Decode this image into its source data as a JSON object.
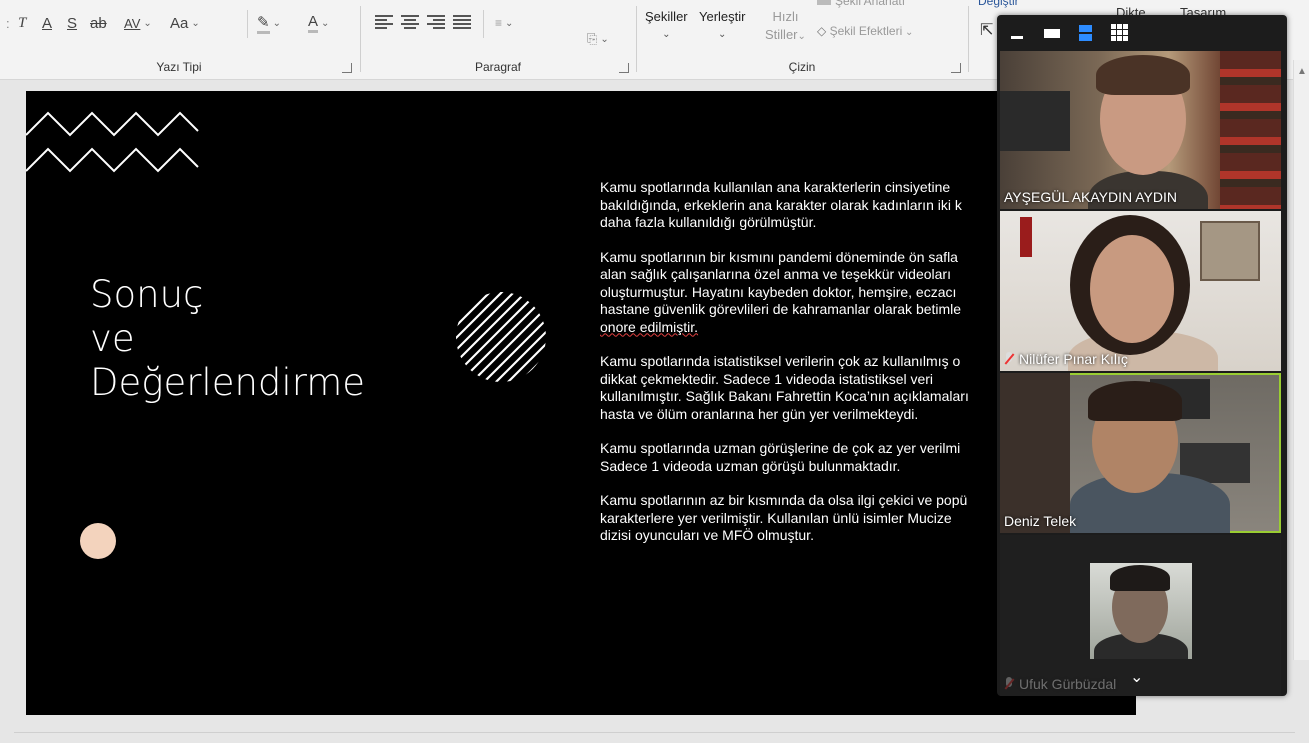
{
  "ribbon": {
    "font_group": {
      "label": "Yazı Tipi",
      "buttons": {
        "italic": "T",
        "underline": "A",
        "shadow": "S",
        "strike": "ab",
        "spacing": "AV",
        "case": "Aa",
        "highlight": "✎",
        "font_color": "A"
      }
    },
    "paragraph_group": {
      "label": "Paragraf"
    },
    "drawing_group": {
      "label": "Çizin",
      "shapes_label": "Şekiller",
      "arrange_label": "Yerleştir",
      "quick_styles_label_1": "Hızlı",
      "quick_styles_label_2": "Stiller",
      "shape_fill_label": "Şekil Anahatı",
      "shape_effects_label": "Şekil Efektleri",
      "change_label": "Değiştir"
    },
    "right_tabs": [
      "Dikte",
      "Tasarım"
    ]
  },
  "slide": {
    "title_lines": [
      "Sonuç",
      "ve",
      "Değerlendirme"
    ],
    "paragraphs": [
      [
        "Kamu spotlarında kullanılan ana karakterlerin cinsiyetine",
        "bakıldığında, erkeklerin ana karakter olarak kadınların iki k",
        "daha fazla kullanıldığı görülmüştür."
      ],
      [
        "Kamu spotlarının bir kısmını pandemi döneminde ön safla",
        "alan sağlık çalışanlarına özel anma ve teşekkür videoları",
        "oluşturmuştur. Hayatını kaybeden doktor, hemşire, eczacı",
        "hastane güvenlik görevlileri de kahramanlar olarak betimle",
        "onore edilmiştir."
      ],
      [
        "Kamu spotlarında istatistiksel verilerin çok az kullanılmış o",
        "dikkat çekmektedir. Sadece 1 videoda istatistiksel veri",
        "kullanılmıştır. Sağlık Bakanı Fahrettin Koca’nın açıklamaları",
        "hasta ve ölüm oranlarına her gün yer verilmekteydi."
      ],
      [
        "Kamu spotlarında uzman görüşlerine de çok az yer verilmi",
        "Sadece 1 videoda uzman görüşü bulunmaktadır."
      ],
      [
        "Kamu spotlarının az bir kısmında da olsa ilgi çekici ve popü",
        "karakterlere yer verilmiştir. Kullanılan ünlü isimler Mucize",
        "dizisi oyuncuları ve MFÖ olmuştur."
      ]
    ]
  },
  "zoom": {
    "participants": [
      {
        "name": "AYŞEGÜL AKAYDIN AYDIN",
        "muted": false
      },
      {
        "name": "Nilüfer Pınar Kılıç",
        "muted": true
      },
      {
        "name": "Deniz Telek",
        "muted": false
      },
      {
        "name": "Ufuk Gürbüzdal",
        "muted": true
      }
    ]
  },
  "colors": {
    "ribbon_bg": "#f3f3f3",
    "slide_bg": "#000000",
    "accent_dot": "#f3d3bd",
    "active_speaker": "#9acd32",
    "zoom_bg": "#1c1c1c",
    "zoom_blue": "#2d8cff"
  }
}
